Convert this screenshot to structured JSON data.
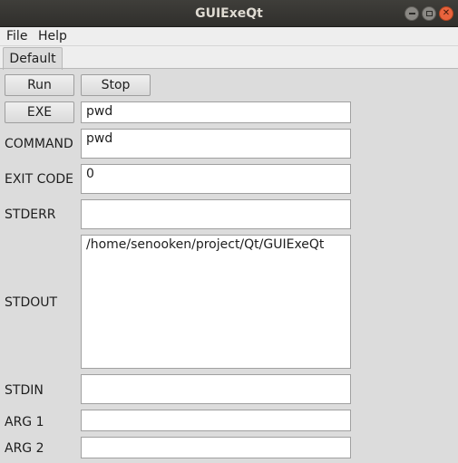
{
  "window": {
    "title": "GUIExeQt"
  },
  "menubar": {
    "file": "File",
    "help": "Help"
  },
  "tabs": [
    {
      "label": "Default"
    }
  ],
  "controls": {
    "run_label": "Run",
    "stop_label": "Stop",
    "exe_label": "EXE",
    "exe_value": "pwd"
  },
  "labels": {
    "command": "COMMAND",
    "exit_code": "EXIT CODE",
    "stderr": "STDERR",
    "stdout": "STDOUT",
    "stdin": "STDIN",
    "arg1": "ARG 1",
    "arg2": "ARG 2"
  },
  "values": {
    "command": "pwd",
    "exit_code": "0",
    "stderr": "",
    "stdout": "/home/senooken/project/Qt/GUIExeQt",
    "stdin": "",
    "arg1": "",
    "arg2": ""
  }
}
